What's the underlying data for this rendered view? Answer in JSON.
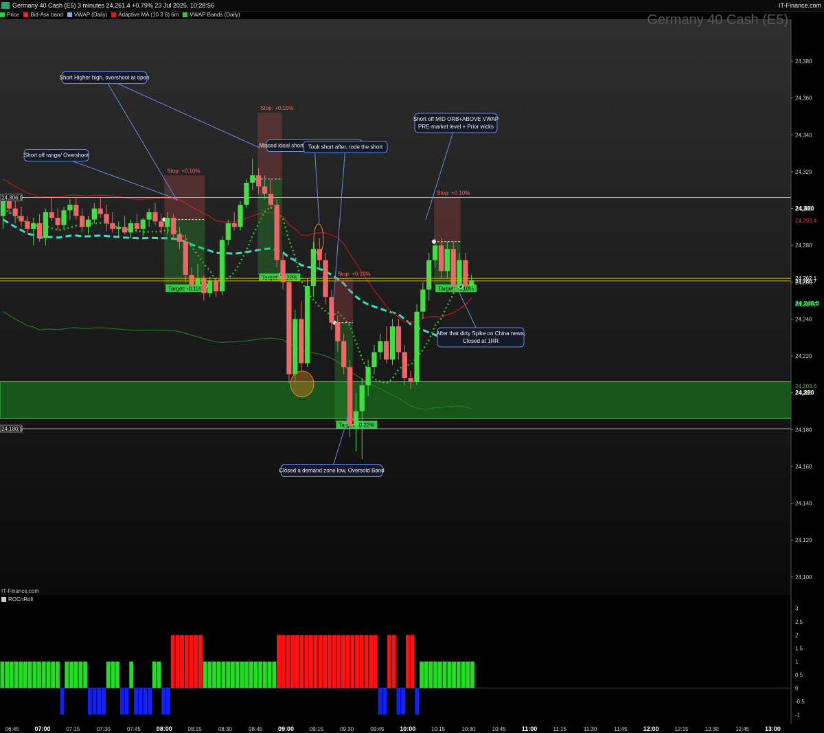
{
  "header": {
    "info": "Germany 40 Cash (E5) 3 minutes 24,261.4 +0.79% 23 Jul 2025, 10:28:56",
    "brand": "IT-Finance.com",
    "watermark": "Germany 40 Cash (E5)",
    "source": "IT-Finance.com"
  },
  "legend": [
    {
      "label": "Price",
      "color": "#2ecc40"
    },
    {
      "label": "Bid-Ask band",
      "color": "#cc3333"
    },
    {
      "label": "VWAP (Daily)",
      "color": "#7ab0d8"
    },
    {
      "label": "Adaptive MA (10 3 6) 6m",
      "color": "#cc2222"
    },
    {
      "label": "VWAP Bands (Daily)",
      "color": "#2ecc40"
    }
  ],
  "oscillator": {
    "label": "ROCnRoll"
  },
  "chart_data": [
    {
      "type": "candlestick",
      "title": "Germany 40 Cash (E5)",
      "timeframe": "3 minutes",
      "y_axis": {
        "ticks": [
          24100,
          24120,
          24140,
          24160,
          24180,
          24200,
          24220,
          24240,
          24260,
          24280,
          24300,
          24320,
          24340,
          24360,
          24380
        ],
        "tick_labels": [
          "24,100",
          "24,120",
          "24,140",
          "24,160",
          "24,180",
          "24,200",
          "24,220",
          "24,240",
          "24,260",
          "24,280",
          "24,300",
          "24,320",
          "24,340",
          "24,360",
          "24,380"
        ],
        "range": [
          24091,
          24402
        ]
      },
      "x_axis": {
        "tick_labels": [
          "06:45",
          "07:00",
          "07:15",
          "07:30",
          "07:45",
          "08:00",
          "08:15",
          "08:30",
          "08:45",
          "09:00",
          "09:15",
          "09:30",
          "09:45",
          "10:00",
          "10:15",
          "10:30",
          "10:45",
          "11:00",
          "11:15",
          "11:30",
          "11:45",
          "12:00",
          "12:15",
          "12:30",
          "12:45",
          "13:00"
        ],
        "bold_labels": [
          "07:00",
          "08:00",
          "09:00",
          "10:00",
          "11:00",
          "12:00",
          "13:00"
        ],
        "range": [
          "06:39",
          "13:09"
        ]
      },
      "price_tags": [
        {
          "label": "24,306.0",
          "value": 24306.0,
          "side": "left",
          "color": "#ffffff"
        },
        {
          "label": "24,180.5",
          "value": 24180.5,
          "side": "left",
          "color": "#ffffff"
        },
        {
          "label": "24,300",
          "value": 24300,
          "side": "right",
          "color": "#ffffff",
          "bold": true
        },
        {
          "label": "24,293.4",
          "value": 24293.4,
          "side": "right",
          "color": "#ff3333"
        },
        {
          "label": "24,262.1",
          "value": 24262.1,
          "side": "right",
          "color": "#ffffff"
        },
        {
          "label": "24,260.7",
          "value": 24260.7,
          "side": "right",
          "color": "#ffffff"
        },
        {
          "label": "24,248.5",
          "value": 24248.5,
          "side": "right",
          "color": "#40ff60",
          "bold": true
        },
        {
          "label": "24,248.0",
          "value": 24248.0,
          "side": "right",
          "color": "#40ff60"
        },
        {
          "label": "24,203.6",
          "value": 24203.6,
          "side": "right",
          "color": "#2ecc40"
        },
        {
          "label": "24,200",
          "value": 24200,
          "side": "right",
          "color": "#ffffff",
          "bold": true
        }
      ],
      "horizontal_lines": [
        {
          "value": 24306.0,
          "color": "#aaaaaa"
        },
        {
          "value": 24180.5,
          "color": "#aaaaaa"
        },
        {
          "value": 24262.1,
          "color": "#c8b400"
        },
        {
          "value": 24260.7,
          "color": "#c8b400"
        }
      ],
      "demand_zone": {
        "from": 24186,
        "to": 24206,
        "color": "#1a6b1a"
      },
      "candles": [
        {
          "t": "06:39",
          "o": 24296,
          "h": 24306,
          "l": 24289,
          "c": 24304
        },
        {
          "t": "06:42",
          "o": 24304,
          "h": 24307,
          "l": 24297,
          "c": 24300
        },
        {
          "t": "06:45",
          "o": 24300,
          "h": 24304,
          "l": 24292,
          "c": 24296
        },
        {
          "t": "06:48",
          "o": 24296,
          "h": 24301,
          "l": 24290,
          "c": 24293
        },
        {
          "t": "06:51",
          "o": 24293,
          "h": 24296,
          "l": 24286,
          "c": 24289
        },
        {
          "t": "06:54",
          "o": 24289,
          "h": 24295,
          "l": 24280,
          "c": 24292
        },
        {
          "t": "06:57",
          "o": 24292,
          "h": 24297,
          "l": 24282,
          "c": 24284
        },
        {
          "t": "07:00",
          "o": 24284,
          "h": 24300,
          "l": 24280,
          "c": 24298
        },
        {
          "t": "07:03",
          "o": 24298,
          "h": 24306,
          "l": 24293,
          "c": 24295
        },
        {
          "t": "07:06",
          "o": 24295,
          "h": 24300,
          "l": 24288,
          "c": 24291
        },
        {
          "t": "07:09",
          "o": 24291,
          "h": 24301,
          "l": 24289,
          "c": 24299
        },
        {
          "t": "07:12",
          "o": 24299,
          "h": 24305,
          "l": 24294,
          "c": 24302
        },
        {
          "t": "07:15",
          "o": 24302,
          "h": 24306,
          "l": 24294,
          "c": 24296
        },
        {
          "t": "07:18",
          "o": 24296,
          "h": 24300,
          "l": 24287,
          "c": 24290
        },
        {
          "t": "07:21",
          "o": 24290,
          "h": 24296,
          "l": 24286,
          "c": 24294
        },
        {
          "t": "07:24",
          "o": 24294,
          "h": 24303,
          "l": 24292,
          "c": 24300
        },
        {
          "t": "07:27",
          "o": 24300,
          "h": 24306,
          "l": 24295,
          "c": 24297
        },
        {
          "t": "07:30",
          "o": 24297,
          "h": 24302,
          "l": 24288,
          "c": 24292
        },
        {
          "t": "07:33",
          "o": 24292,
          "h": 24298,
          "l": 24287,
          "c": 24289
        },
        {
          "t": "07:36",
          "o": 24289,
          "h": 24293,
          "l": 24284,
          "c": 24290
        },
        {
          "t": "07:39",
          "o": 24290,
          "h": 24296,
          "l": 24286,
          "c": 24287
        },
        {
          "t": "07:42",
          "o": 24287,
          "h": 24294,
          "l": 24284,
          "c": 24292
        },
        {
          "t": "07:45",
          "o": 24292,
          "h": 24297,
          "l": 24287,
          "c": 24289
        },
        {
          "t": "07:48",
          "o": 24289,
          "h": 24295,
          "l": 24285,
          "c": 24294
        },
        {
          "t": "07:51",
          "o": 24294,
          "h": 24300,
          "l": 24290,
          "c": 24298
        },
        {
          "t": "07:54",
          "o": 24298,
          "h": 24303,
          "l": 24291,
          "c": 24293
        },
        {
          "t": "07:57",
          "o": 24293,
          "h": 24297,
          "l": 24286,
          "c": 24290
        },
        {
          "t": "08:00",
          "o": 24290,
          "h": 24298,
          "l": 24286,
          "c": 24295
        },
        {
          "t": "08:03",
          "o": 24295,
          "h": 24297,
          "l": 24284,
          "c": 24286
        },
        {
          "t": "08:06",
          "o": 24286,
          "h": 24290,
          "l": 24278,
          "c": 24282
        },
        {
          "t": "08:09",
          "o": 24282,
          "h": 24286,
          "l": 24260,
          "c": 24264
        },
        {
          "t": "08:12",
          "o": 24264,
          "h": 24268,
          "l": 24255,
          "c": 24258
        },
        {
          "t": "08:15",
          "o": 24258,
          "h": 24270,
          "l": 24256,
          "c": 24262
        },
        {
          "t": "08:18",
          "o": 24262,
          "h": 24264,
          "l": 24250,
          "c": 24254
        },
        {
          "t": "08:21",
          "o": 24254,
          "h": 24263,
          "l": 24252,
          "c": 24261
        },
        {
          "t": "08:24",
          "o": 24261,
          "h": 24262,
          "l": 24252,
          "c": 24255
        },
        {
          "t": "08:27",
          "o": 24255,
          "h": 24285,
          "l": 24253,
          "c": 24283
        },
        {
          "t": "08:30",
          "o": 24283,
          "h": 24294,
          "l": 24280,
          "c": 24292
        },
        {
          "t": "08:33",
          "o": 24292,
          "h": 24298,
          "l": 24288,
          "c": 24290
        },
        {
          "t": "08:36",
          "o": 24290,
          "h": 24304,
          "l": 24288,
          "c": 24302
        },
        {
          "t": "08:39",
          "o": 24302,
          "h": 24316,
          "l": 24300,
          "c": 24314
        },
        {
          "t": "08:42",
          "o": 24314,
          "h": 24327,
          "l": 24310,
          "c": 24318
        },
        {
          "t": "08:45",
          "o": 24318,
          "h": 24322,
          "l": 24308,
          "c": 24312
        },
        {
          "t": "08:48",
          "o": 24312,
          "h": 24318,
          "l": 24305,
          "c": 24308
        },
        {
          "t": "08:51",
          "o": 24308,
          "h": 24316,
          "l": 24300,
          "c": 24302
        },
        {
          "t": "08:54",
          "o": 24302,
          "h": 24305,
          "l": 24268,
          "c": 24272
        },
        {
          "t": "08:57",
          "o": 24272,
          "h": 24276,
          "l": 24256,
          "c": 24260
        },
        {
          "t": "09:00",
          "o": 24260,
          "h": 24262,
          "l": 24205,
          "c": 24210
        },
        {
          "t": "09:03",
          "o": 24210,
          "h": 24245,
          "l": 24206,
          "c": 24240
        },
        {
          "t": "09:06",
          "o": 24240,
          "h": 24250,
          "l": 24212,
          "c": 24216
        },
        {
          "t": "09:09",
          "o": 24216,
          "h": 24262,
          "l": 24214,
          "c": 24258
        },
        {
          "t": "09:12",
          "o": 24258,
          "h": 24282,
          "l": 24252,
          "c": 24278
        },
        {
          "t": "09:15",
          "o": 24278,
          "h": 24284,
          "l": 24268,
          "c": 24272
        },
        {
          "t": "09:18",
          "o": 24272,
          "h": 24276,
          "l": 24248,
          "c": 24252
        },
        {
          "t": "09:21",
          "o": 24252,
          "h": 24256,
          "l": 24234,
          "c": 24238
        },
        {
          "t": "09:24",
          "o": 24238,
          "h": 24242,
          "l": 24222,
          "c": 24228
        },
        {
          "t": "09:27",
          "o": 24228,
          "h": 24232,
          "l": 24210,
          "c": 24214
        },
        {
          "t": "09:30",
          "o": 24214,
          "h": 24218,
          "l": 24176,
          "c": 24182
        },
        {
          "t": "09:33",
          "o": 24182,
          "h": 24200,
          "l": 24168,
          "c": 24190
        },
        {
          "t": "09:36",
          "o": 24190,
          "h": 24208,
          "l": 24164,
          "c": 24204
        },
        {
          "t": "09:39",
          "o": 24204,
          "h": 24218,
          "l": 24198,
          "c": 24214
        },
        {
          "t": "09:42",
          "o": 24214,
          "h": 24226,
          "l": 24210,
          "c": 24222
        },
        {
          "t": "09:45",
          "o": 24222,
          "h": 24232,
          "l": 24218,
          "c": 24228
        },
        {
          "t": "09:48",
          "o": 24228,
          "h": 24236,
          "l": 24216,
          "c": 24218
        },
        {
          "t": "09:51",
          "o": 24218,
          "h": 24240,
          "l": 24215,
          "c": 24236
        },
        {
          "t": "09:54",
          "o": 24236,
          "h": 24240,
          "l": 24218,
          "c": 24222
        },
        {
          "t": "09:57",
          "o": 24222,
          "h": 24226,
          "l": 24204,
          "c": 24208
        },
        {
          "t": "10:00",
          "o": 24208,
          "h": 24212,
          "l": 24202,
          "c": 24206
        },
        {
          "t": "10:03",
          "o": 24206,
          "h": 24248,
          "l": 24204,
          "c": 24244
        },
        {
          "t": "10:06",
          "o": 24244,
          "h": 24260,
          "l": 24240,
          "c": 24256
        },
        {
          "t": "10:09",
          "o": 24256,
          "h": 24276,
          "l": 24250,
          "c": 24272
        },
        {
          "t": "10:12",
          "o": 24272,
          "h": 24284,
          "l": 24268,
          "c": 24280
        },
        {
          "t": "10:15",
          "o": 24280,
          "h": 24284,
          "l": 24262,
          "c": 24266
        },
        {
          "t": "10:18",
          "o": 24266,
          "h": 24282,
          "l": 24262,
          "c": 24278
        },
        {
          "t": "10:21",
          "o": 24278,
          "h": 24282,
          "l": 24254,
          "c": 24258
        },
        {
          "t": "10:24",
          "o": 24258,
          "h": 24276,
          "l": 24254,
          "c": 24272
        },
        {
          "t": "10:27",
          "o": 24272,
          "h": 24276,
          "l": 24256,
          "c": 24258
        },
        {
          "t": "10:30",
          "o": 24258,
          "h": 24264,
          "l": 24255,
          "c": 24261
        }
      ],
      "trade_boxes": [
        {
          "entry_time": "08:00",
          "exit_time": "08:20",
          "entry": 24294,
          "stop_label": "Stop: +0.10%",
          "target_label": "Target: -0.15%",
          "stop": 24318,
          "target": 24258,
          "target_color": "#2ecc40"
        },
        {
          "entry_time": "08:46",
          "exit_time": "08:58",
          "entry": 24316,
          "stop_label": "Stop: +0.15%",
          "target_label": "Target: -0.20%",
          "stop": 24352,
          "target": 24264,
          "target_color": "#2ecc40"
        },
        {
          "entry_time": "09:24",
          "exit_time": "09:33",
          "entry": 24238,
          "stop_label": "Stop: +0.10%",
          "target_label": "Target: -0.22%",
          "stop": 24262,
          "target": 24184,
          "target_color": "#2ecc40"
        },
        {
          "entry_time": "10:13",
          "exit_time": "10:26",
          "entry": 24282,
          "stop_label": "Stop: +0.10%",
          "target_label": "Target: -0.10%",
          "stop": 24306,
          "target": 24258,
          "target_color": "#2ecc40"
        }
      ],
      "annotations": [
        {
          "text": "Short Higher high, overshoot at open"
        },
        {
          "text": "Short off range/ Overshoot"
        },
        {
          "text": "Missed ideal short above VWAP for 9abc trap"
        },
        {
          "text": "Took short after, rode the short"
        },
        {
          "text": "Short off MID ORB+ABOVE VWAP"
        },
        {
          "text": "PRE-market level + Prior wicks"
        },
        {
          "text": "After that dirty Spike on China news,"
        },
        {
          "text": "Closed at 1RR"
        },
        {
          "text": "Closed a demand zone low, Oversold Band"
        }
      ]
    },
    {
      "type": "bar",
      "title": "ROCnRoll",
      "y_axis": {
        "ticks": [
          -1,
          -0.5,
          0,
          0.5,
          1,
          1.5,
          2,
          2.5,
          3
        ],
        "tick_labels": [
          "-1",
          "-0.5",
          "0",
          "0.5",
          "1",
          "1.5",
          "2",
          "2.5",
          "3"
        ],
        "range": [
          -1.2,
          3.2
        ]
      },
      "series": [
        {
          "color": "#22dd22",
          "values_label": "value 1"
        },
        {
          "color": "#ff1111",
          "values_label": "value 2"
        },
        {
          "color": "#1020ff",
          "values_label": "value -1"
        }
      ],
      "values": [
        1,
        1,
        1,
        1,
        1,
        1,
        1,
        1,
        1,
        1,
        1,
        1,
        1,
        -1,
        1,
        1,
        1,
        1,
        1,
        -1,
        -1,
        -1,
        -1,
        1,
        1,
        1,
        -1,
        -1,
        1,
        -1,
        -1,
        -1,
        -1,
        1,
        1,
        -1,
        -1,
        2,
        2,
        2,
        2,
        2,
        2,
        2,
        1,
        1,
        1,
        1,
        1,
        1,
        1,
        1,
        1,
        1,
        1,
        1,
        1,
        1,
        1,
        1,
        2,
        2,
        2,
        2,
        2,
        2,
        2,
        2,
        2,
        2,
        2,
        2,
        2,
        2,
        2,
        2,
        2,
        2,
        2,
        2,
        2,
        2,
        -1,
        -1,
        2,
        2,
        -1,
        -1,
        2,
        2,
        -1,
        1,
        1,
        1,
        1,
        1,
        1,
        1,
        1,
        1,
        1,
        1,
        1
      ]
    }
  ]
}
